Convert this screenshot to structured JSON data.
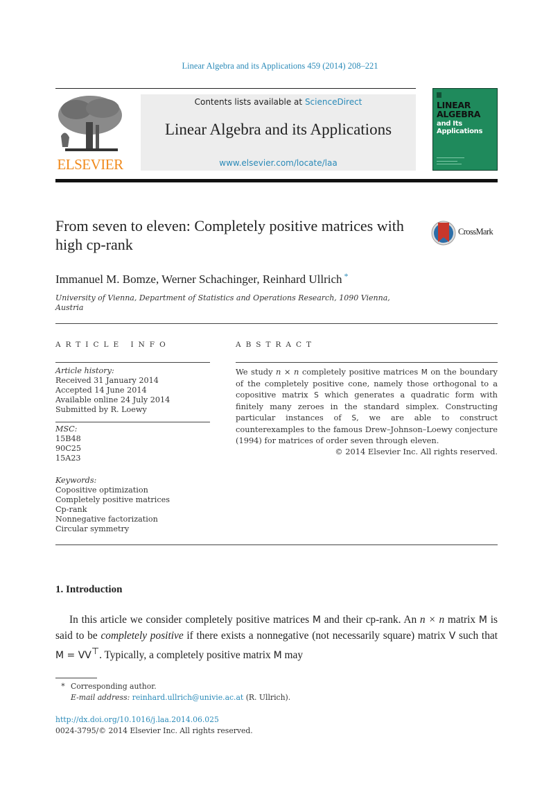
{
  "header": {
    "citation": "Linear Algebra and its Applications 459 (2014) 208–221",
    "contents_prefix": "Contents lists available at ",
    "contents_link": "ScienceDirect",
    "journal_name": "Linear Algebra and its Applications",
    "journal_url": "www.elsevier.com/locate/laa",
    "publisher_logo_text": "ELSEVIER",
    "cover": {
      "title_line1": "LINEAR",
      "title_line2": "ALGEBRA",
      "sub_line1": "and Its",
      "sub_line2": "Applications",
      "color": "#1f8a5c"
    }
  },
  "article": {
    "title": "From seven to eleven: Completely positive matrices with high cp-rank",
    "crossmark_label": "CrossMark",
    "authors": "Immanuel M. Bomze, Werner Schachinger, Reinhard Ullrich",
    "author_mark": "*",
    "affiliation": "University of Vienna, Department of Statistics and Operations Research, 1090 Vienna, Austria"
  },
  "article_info": {
    "heading": "ARTICLE INFO",
    "history_label": "Article history:",
    "history": [
      "Received 31 January 2014",
      "Accepted 14 June 2014",
      "Available online 24 July 2014",
      "Submitted by R. Loewy"
    ],
    "msc_label": "MSC:",
    "msc": [
      "15B48",
      "90C25",
      "15A23"
    ],
    "keywords_label": "Keywords:",
    "keywords": [
      "Copositive optimization",
      "Completely positive matrices",
      "Cp-rank",
      "Nonnegative factorization",
      "Circular symmetry"
    ]
  },
  "abstract": {
    "heading": "ABSTRACT",
    "p1": "We study ",
    "n1": "n × n",
    "p2": " completely positive matrices ",
    "M": "M",
    "p3": " on the boundary of the completely positive cone, namely those orthogonal to a copositive matrix ",
    "S": "S",
    "p4": " which generates a quadratic form with finitely many zeroes in the standard simplex. Constructing particular instances of ",
    "p5": ", we are able to construct counterexamples to the famous Drew–Johnson–Loewy conjecture (1994) for matrices of order seven through eleven.",
    "copyright": "© 2014 Elsevier Inc. All rights reserved."
  },
  "introduction": {
    "heading": "1.  Introduction",
    "s1": "In this article we consider completely positive matrices ",
    "M": "M",
    "s2": " and their cp-rank. An ",
    "nxn": "n × n",
    "s3": " matrix ",
    "s4": " is said to be ",
    "em": "completely positive",
    "s5": " if there exists a nonnegative (not necessarily square) matrix ",
    "V": "V",
    "s6": " such that ",
    "eq": "M = VV",
    "sup": "⊤",
    "s7": ". Typically, a completely positive matrix ",
    "s8": " may"
  },
  "footnote": {
    "mark": "*",
    "corresponding": "Corresponding author.",
    "email_label": "E-mail address:",
    "email": "reinhard.ullrich@univie.ac.at",
    "email_suffix": " (R. Ullrich).",
    "doi": "http://dx.doi.org/10.1016/j.laa.2014.06.025",
    "issn": "0024-3795/© 2014 Elsevier Inc. All rights reserved."
  }
}
